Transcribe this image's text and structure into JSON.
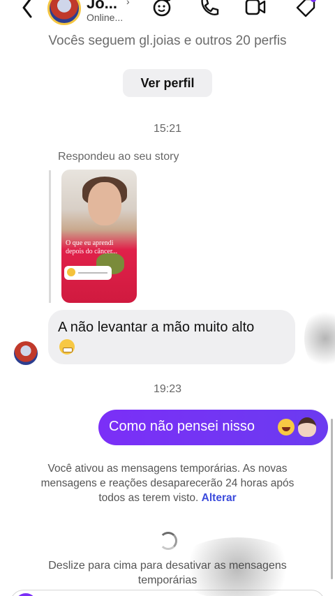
{
  "header": {
    "contact_name": "Jo...",
    "chevron_glyph": "›",
    "status": "Online...",
    "icons": [
      "back-chevron-icon",
      "sticker-icon",
      "phone-icon",
      "video-icon",
      "tag-icon"
    ]
  },
  "followers_text": "Vocês seguem gl.joias e outros 20 perfis",
  "view_profile_label": "Ver perfil",
  "messages": {
    "time_1": "15:21",
    "replied_label": "Respondeu ao seu story",
    "story_text": "O que eu aprendi depois do câncer...",
    "incoming_text": "A não levantar a mão muito alto",
    "incoming_emoji": "grinning-face-emoji",
    "time_2": "19:23",
    "outgoing_text": "Como não pensei nisso",
    "outgoing_emojis": [
      "laughing-tears-emoji",
      "facepalm-emoji"
    ]
  },
  "notice": {
    "text": "Você ativou as mensagens temporárias. As novas mensagens e reações desaparecerão 24 horas após todos as terem visto.",
    "link": "Alterar"
  },
  "swipe_text": "Deslize para cima para desativar as mensagens temporárias",
  "colors": {
    "accent": "#7b2ff7",
    "link": "#3b4bdc",
    "incoming_bubble": "#efeff1"
  }
}
